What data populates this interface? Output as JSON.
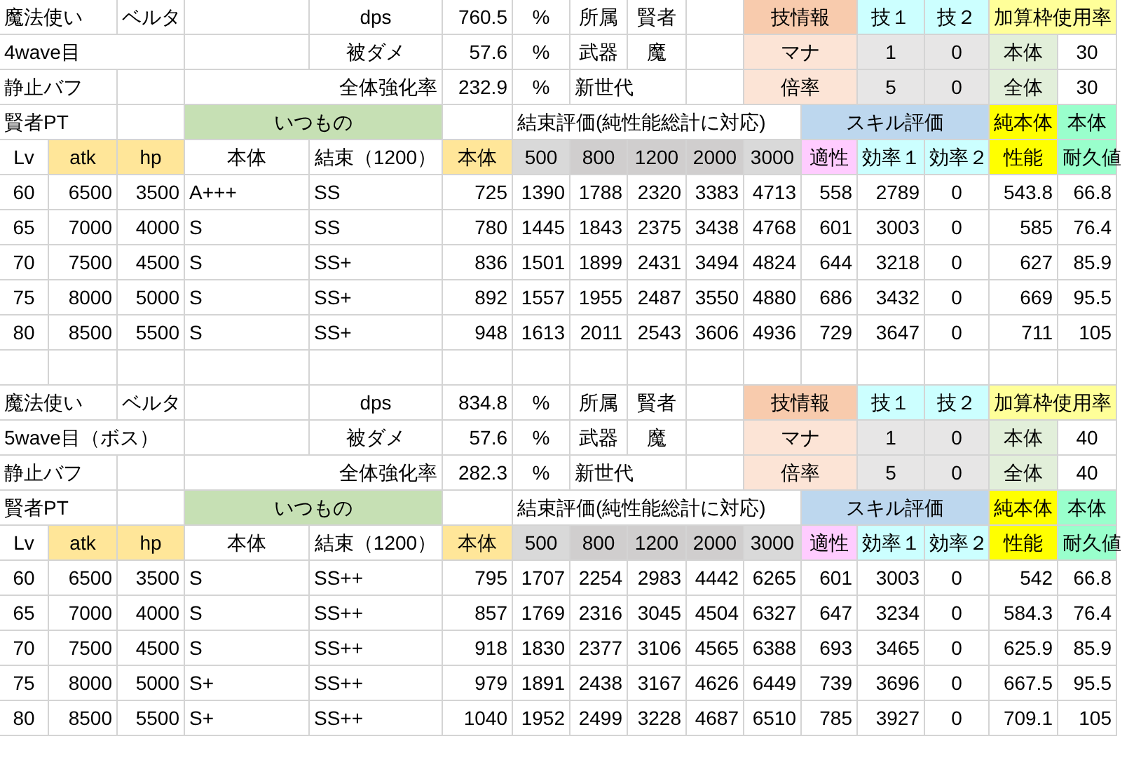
{
  "blocks": [
    {
      "job": "魔法使い",
      "character": "ベルタ",
      "wave": "4wave目",
      "buff": "静止バフ",
      "stats": [
        {
          "label": "dps",
          "value": "760.5",
          "unit": "%"
        },
        {
          "label": "被ダメ",
          "value": "57.6",
          "unit": "%"
        },
        {
          "label": "全体強化率",
          "value": "232.9",
          "unit": "%"
        }
      ],
      "affiliation": {
        "label": "所属",
        "value": "賢者"
      },
      "weapon": {
        "label": "武器",
        "value": "魔"
      },
      "generation": "新世代",
      "skill_info": {
        "title": "技情報",
        "columns": [
          "技１",
          "技２"
        ],
        "rows": [
          {
            "label": "マナ",
            "values": [
              "1",
              "0"
            ]
          },
          {
            "label": "倍率",
            "values": [
              "5",
              "0"
            ]
          }
        ]
      },
      "usage": {
        "title": "加算枠使用率",
        "rows": [
          {
            "label": "本体",
            "value": "30"
          },
          {
            "label": "全体",
            "value": "30"
          }
        ]
      },
      "party": "賢者PT",
      "usual": "いつもの",
      "bond_eval": "結束評価(純性能総計に対応)",
      "skill_eval": "スキル評価",
      "pure_top": "純本体",
      "body_top": "本体",
      "columns": [
        "Lv",
        "atk",
        "hp",
        "本体",
        "結束（1200）",
        "本体",
        "500",
        "800",
        "1200",
        "2000",
        "3000",
        "適性",
        "効率１",
        "効率２",
        "性能",
        "耐久値"
      ],
      "rows": [
        [
          "60",
          "6500",
          "3500",
          "A+++",
          "SS",
          "725",
          "1390",
          "1788",
          "2320",
          "3383",
          "4713",
          "558",
          "2789",
          "0",
          "543.8",
          "66.8"
        ],
        [
          "65",
          "7000",
          "4000",
          "S",
          "SS",
          "780",
          "1445",
          "1843",
          "2375",
          "3438",
          "4768",
          "601",
          "3003",
          "0",
          "585",
          "76.4"
        ],
        [
          "70",
          "7500",
          "4500",
          "S",
          "SS+",
          "836",
          "1501",
          "1899",
          "2431",
          "3494",
          "4824",
          "644",
          "3218",
          "0",
          "627",
          "85.9"
        ],
        [
          "75",
          "8000",
          "5000",
          "S",
          "SS+",
          "892",
          "1557",
          "1955",
          "2487",
          "3550",
          "4880",
          "686",
          "3432",
          "0",
          "669",
          "95.5"
        ],
        [
          "80",
          "8500",
          "5500",
          "S",
          "SS+",
          "948",
          "1613",
          "2011",
          "2543",
          "3606",
          "4936",
          "729",
          "3647",
          "0",
          "711",
          "105"
        ]
      ]
    },
    {
      "job": "魔法使い",
      "character": "ベルタ",
      "wave": "5wave目（ボス）",
      "buff": "静止バフ",
      "stats": [
        {
          "label": "dps",
          "value": "834.8",
          "unit": "%"
        },
        {
          "label": "被ダメ",
          "value": "57.6",
          "unit": "%"
        },
        {
          "label": "全体強化率",
          "value": "282.3",
          "unit": "%"
        }
      ],
      "affiliation": {
        "label": "所属",
        "value": "賢者"
      },
      "weapon": {
        "label": "武器",
        "value": "魔"
      },
      "generation": "新世代",
      "skill_info": {
        "title": "技情報",
        "columns": [
          "技１",
          "技２"
        ],
        "rows": [
          {
            "label": "マナ",
            "values": [
              "1",
              "0"
            ]
          },
          {
            "label": "倍率",
            "values": [
              "5",
              "0"
            ]
          }
        ]
      },
      "usage": {
        "title": "加算枠使用率",
        "rows": [
          {
            "label": "本体",
            "value": "40"
          },
          {
            "label": "全体",
            "value": "40"
          }
        ]
      },
      "party": "賢者PT",
      "usual": "いつもの",
      "bond_eval": "結束評価(純性能総計に対応)",
      "skill_eval": "スキル評価",
      "pure_top": "純本体",
      "body_top": "本体",
      "columns": [
        "Lv",
        "atk",
        "hp",
        "本体",
        "結束（1200）",
        "本体",
        "500",
        "800",
        "1200",
        "2000",
        "3000",
        "適性",
        "効率１",
        "効率２",
        "性能",
        "耐久値"
      ],
      "rows": [
        [
          "60",
          "6500",
          "3500",
          "S",
          "SS++",
          "795",
          "1707",
          "2254",
          "2983",
          "4442",
          "6265",
          "601",
          "3003",
          "0",
          "542",
          "66.8"
        ],
        [
          "65",
          "7000",
          "4000",
          "S",
          "SS++",
          "857",
          "1769",
          "2316",
          "3045",
          "4504",
          "6327",
          "647",
          "3234",
          "0",
          "584.3",
          "76.4"
        ],
        [
          "70",
          "7500",
          "4500",
          "S",
          "SS++",
          "918",
          "1830",
          "2377",
          "3106",
          "4565",
          "6388",
          "693",
          "3465",
          "0",
          "625.9",
          "85.9"
        ],
        [
          "75",
          "8000",
          "5000",
          "S+",
          "SS++",
          "979",
          "1891",
          "2438",
          "3167",
          "4626",
          "6449",
          "739",
          "3696",
          "0",
          "667.5",
          "95.5"
        ],
        [
          "80",
          "8500",
          "5500",
          "S+",
          "SS++",
          "1040",
          "1952",
          "2499",
          "3228",
          "4687",
          "6510",
          "785",
          "3927",
          "0",
          "709.1",
          "105"
        ]
      ]
    }
  ]
}
